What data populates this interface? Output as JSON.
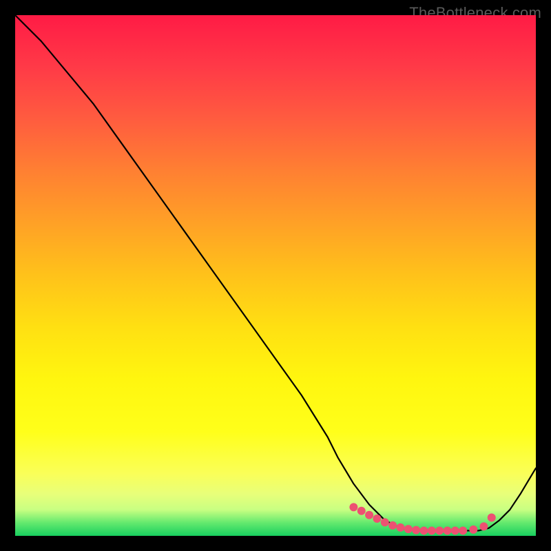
{
  "watermark": "TheBottleneck.com",
  "chart_data": {
    "type": "line",
    "title": "",
    "xlabel": "",
    "ylabel": "",
    "xlim": [
      0,
      100
    ],
    "ylim": [
      0,
      100
    ],
    "grid": false,
    "legend": false,
    "series": [
      {
        "name": "bottleneck-curve",
        "x": [
          0,
          5,
          10,
          15,
          20,
          25,
          30,
          35,
          40,
          45,
          50,
          55,
          60,
          62,
          65,
          68,
          71,
          74,
          77,
          80,
          83,
          86,
          89,
          91,
          93,
          95,
          97,
          100
        ],
        "y": [
          100,
          95,
          89,
          83,
          76,
          69,
          62,
          55,
          48,
          41,
          34,
          27,
          19,
          15,
          10,
          6,
          3,
          1.5,
          1,
          1,
          1,
          1,
          1,
          1.5,
          3,
          5,
          8,
          13
        ]
      }
    ],
    "highlight_dots": {
      "name": "flat-region-dots",
      "x": [
        65,
        66.5,
        68,
        69.5,
        71,
        72.5,
        74,
        75.5,
        77,
        78.5,
        80,
        81.5,
        83,
        84.5,
        86,
        88,
        90,
        91.5
      ],
      "y": [
        5.5,
        4.8,
        4.0,
        3.3,
        2.6,
        2.0,
        1.6,
        1.3,
        1.1,
        1.0,
        1.0,
        1.0,
        1.0,
        1.0,
        1.0,
        1.2,
        1.8,
        3.5
      ]
    },
    "dot_color": "#ed5172",
    "curve_color": "#000000"
  }
}
